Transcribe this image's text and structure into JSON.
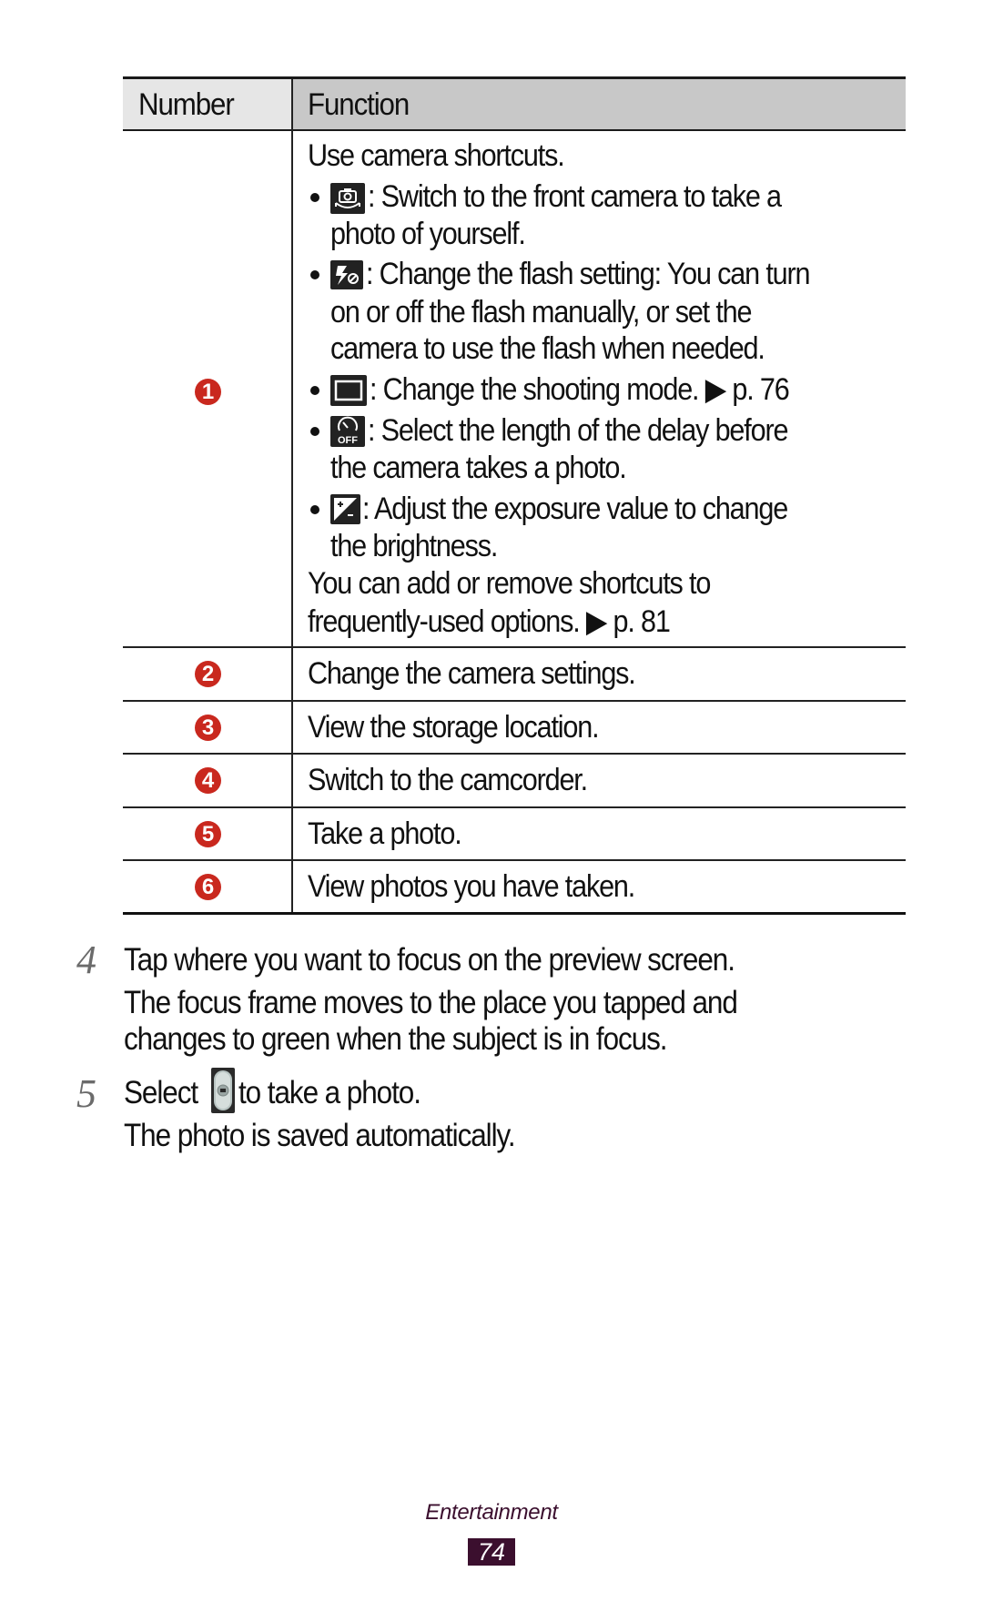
{
  "table": {
    "headers": {
      "number": "Number",
      "function": "Function"
    },
    "rows": [
      {
        "number": "1",
        "intro": "Use camera shortcuts.",
        "bullets": [
          {
            "icon": "switch-camera-icon",
            "lines": [
              ": Switch to the front camera to take a",
              "photo of yourself."
            ]
          },
          {
            "icon": "flash-off-icon",
            "lines": [
              ": Change the flash setting: You can turn",
              "on or off the flash manually, or set the",
              "camera to use the flash when needed."
            ]
          },
          {
            "icon": "shooting-mode-icon",
            "lines": [
              ": Change the shooting mode. ▶ p. 76"
            ]
          },
          {
            "icon": "timer-off-icon",
            "lines": [
              ": Select the length of the delay before",
              "the camera takes a photo."
            ]
          },
          {
            "icon": "exposure-icon",
            "lines": [
              ": Adjust the exposure value to change",
              "the brightness."
            ]
          }
        ],
        "outro": [
          "You can add or remove shortcuts to",
          "frequently-used options. ▶ p. 81"
        ]
      },
      {
        "number": "2",
        "text": "Change the camera settings."
      },
      {
        "number": "3",
        "text": "View the storage location."
      },
      {
        "number": "4",
        "text": "Switch to the camcorder."
      },
      {
        "number": "5",
        "text": "Take a photo."
      },
      {
        "number": "6",
        "text": "View photos you have taken."
      }
    ]
  },
  "steps": [
    {
      "number": "4",
      "lines": [
        "Tap where you want to focus on the preview screen.",
        "The focus frame moves to the place you tapped and",
        "changes to green when the subject is in focus."
      ]
    },
    {
      "number": "5",
      "before_icon": "Select",
      "icon": "shutter-button-icon",
      "after_icon": "to take a photo.",
      "lines": [
        "The photo is saved automatically."
      ]
    }
  ],
  "footer": {
    "section": "Entertainment",
    "page": "74"
  },
  "colors": {
    "badge": "#c9281e",
    "footer": "#3b0f2e",
    "header_function_bg": "#c8c8c8",
    "header_number_bg": "#e6e6e6"
  }
}
